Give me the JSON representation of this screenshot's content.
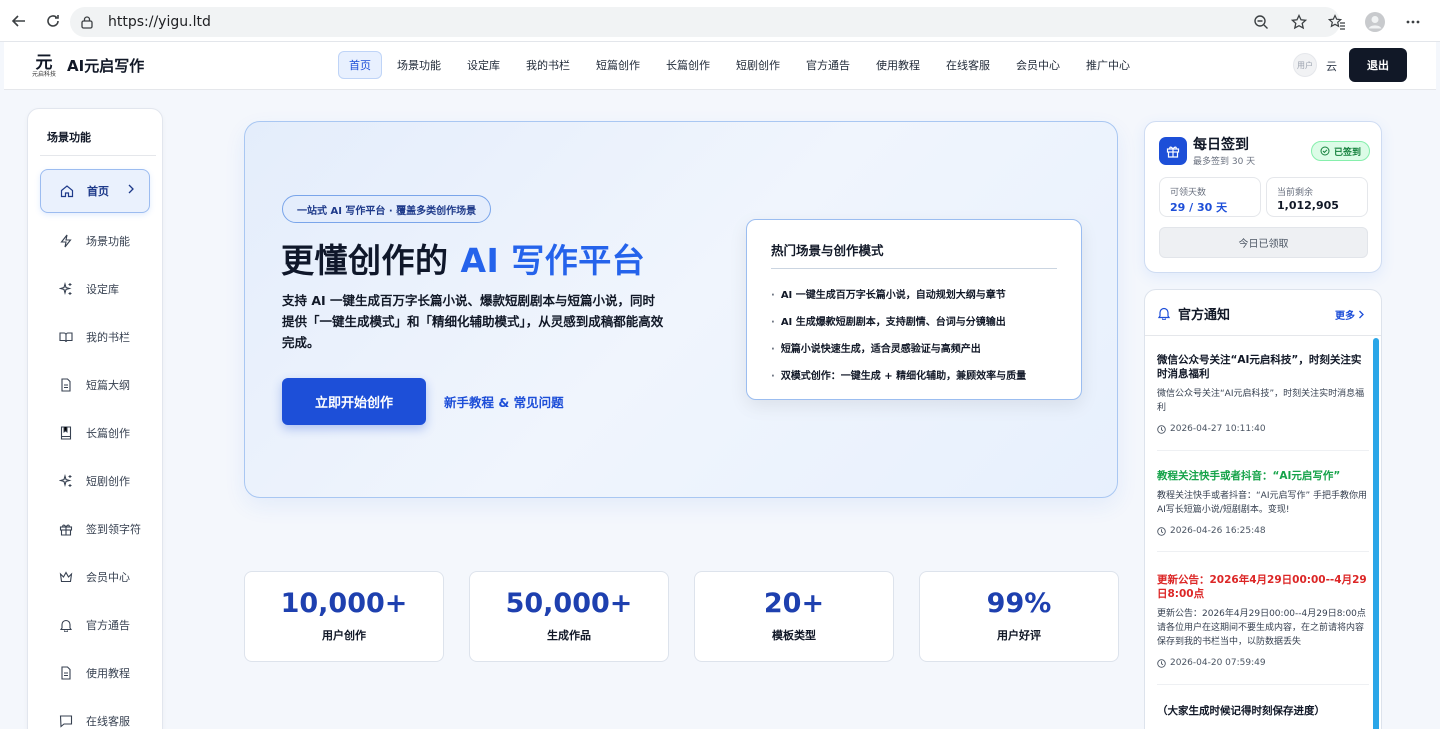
{
  "browser": {
    "url": "https://yigu.ltd"
  },
  "header": {
    "logo_glyph": "元",
    "logo_sub": "元启科技",
    "title": "AI元启写作",
    "nav": [
      "首页",
      "场景功能",
      "设定库",
      "我的书栏",
      "短篇创作",
      "长篇创作",
      "短剧创作",
      "官方通告",
      "使用教程",
      "在线客服",
      "会员中心",
      "推广中心"
    ],
    "avatar_text": "用户",
    "user_name": "云",
    "logout_label": "退出"
  },
  "sidebar": {
    "title": "场景功能",
    "items": [
      {
        "label": "首页",
        "icon": "home-icon"
      },
      {
        "label": "场景功能",
        "icon": "bolt-icon"
      },
      {
        "label": "设定库",
        "icon": "sparkle-icon"
      },
      {
        "label": "我的书栏",
        "icon": "book-open-icon"
      },
      {
        "label": "短篇大纲",
        "icon": "document-icon"
      },
      {
        "label": "长篇创作",
        "icon": "bookmark-book-icon"
      },
      {
        "label": "短剧创作",
        "icon": "sparkle-icon"
      },
      {
        "label": "签到领字符",
        "icon": "gift-icon"
      },
      {
        "label": "会员中心",
        "icon": "crown-icon"
      },
      {
        "label": "官方通告",
        "icon": "bell-icon"
      },
      {
        "label": "使用教程",
        "icon": "document-icon"
      },
      {
        "label": "在线客服",
        "icon": "chat-icon"
      }
    ]
  },
  "hero": {
    "badge": "一站式 AI 写作平台 · 覆盖多类创作场景",
    "title_main": "更懂创作的 ",
    "title_accent": "AI 写作平台",
    "desc": "支持 AI 一键生成百万字长篇小说、爆款短剧剧本与短篇小说，同时提供「一键生成模式」和「精细化辅助模式」，从灵感到成稿都能高效完成。",
    "cta_primary": "立即开始创作",
    "cta_link": "新手教程 & 常见问题",
    "hot": {
      "title": "热门场景与创作模式",
      "items": [
        "AI 一键生成百万字长篇小说，自动规划大纲与章节",
        "AI 生成爆款短剧剧本，支持剧情、台词与分镜输出",
        "短篇小说快速生成，适合灵感验证与高频产出",
        "双模式创作：一键生成 + 精细化辅助，兼顾效率与质量"
      ]
    }
  },
  "stats": [
    {
      "value": "10,000+",
      "label": "用户创作"
    },
    {
      "value": "50,000+",
      "label": "生成作品"
    },
    {
      "value": "20+",
      "label": "模板类型"
    },
    {
      "value": "99%",
      "label": "用户好评"
    }
  ],
  "checkin": {
    "title": "每日签到",
    "subtitle": "最多签到 30 天",
    "status": "已签到",
    "days_label": "可领天数",
    "days_value": "29 / 30 天",
    "remain_label": "当前剩余",
    "remain_value": "1,012,905",
    "button": "今日已领取",
    "colors": {
      "accent": "#1d4fd8",
      "success": "#16a34a"
    }
  },
  "notice": {
    "title": "官方通知",
    "more": "更多",
    "items": [
      {
        "title": "微信公众号关注“AI元启科技”，时刻关注实时消息福利",
        "body": "微信公众号关注“AI元启科技”，时刻关注实时消息福利",
        "time": "2026-04-27 10:11:40",
        "tone": "default"
      },
      {
        "title": "教程关注快手或者抖音：“AI元启写作”",
        "body": "教程关注快手或者抖音：“AI元启写作” 手把手教你用AI写长短篇小说/短剧剧本。变现!",
        "time": "2026-04-26 16:25:48",
        "tone": "green"
      },
      {
        "title": "更新公告：2026年4月29日00:00--4月29日8:00点",
        "body": "更新公告：2026年4月29日00:00--4月29日8:00点请各位用户在这期间不要生成内容，在之前请将内容保存到我的书栏当中，以防数据丢失",
        "time": "2026-04-20 07:59:49",
        "tone": "red"
      },
      {
        "title": "（大家生成时候记得时刻保存进度）",
        "body": "",
        "time": "",
        "tone": "default"
      }
    ]
  }
}
